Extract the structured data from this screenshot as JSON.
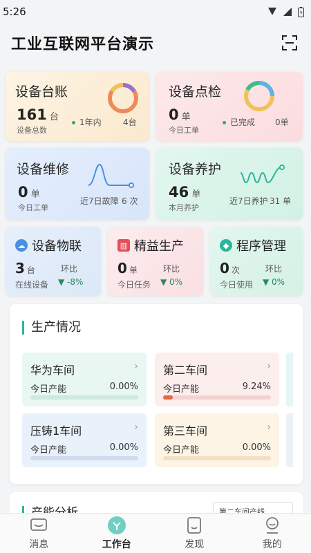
{
  "status": {
    "time": "5:26"
  },
  "header": {
    "title": "工业互联网平台演示"
  },
  "cards": {
    "ledger": {
      "title": "设备台账",
      "value": "161",
      "unit": "台",
      "label": "设备总数",
      "meta_label": "1年内",
      "meta_value": "4台",
      "ring_color": "#3aa66f"
    },
    "inspect": {
      "title": "设备点检",
      "value": "0",
      "unit": "单",
      "label": "今日工单",
      "meta_label": "已完成",
      "meta_value": "0单"
    },
    "repair": {
      "title": "设备维修",
      "value": "0",
      "unit": "单",
      "label": "今日工单",
      "meta_label": "近7日故障",
      "meta_value": "6 次"
    },
    "maint": {
      "title": "设备养护",
      "value": "46",
      "unit": "单",
      "label": "本月养护",
      "meta_label": "近7日养护",
      "meta_value": "31 单"
    }
  },
  "small_cards": {
    "iot": {
      "title": "设备物联",
      "value": "3",
      "unit": "台",
      "label": "在线设备",
      "ring_label": "环比",
      "trend": "▼ -8%"
    },
    "lean": {
      "title": "精益生产",
      "value": "0",
      "unit": "单",
      "label": "今日任务",
      "ring_label": "环比",
      "trend": "▼ 0%"
    },
    "prog": {
      "title": "程序管理",
      "value": "0",
      "unit": "次",
      "label": "今日使用",
      "ring_label": "环比",
      "trend": "▼ 0%"
    }
  },
  "production": {
    "title": "生产情况",
    "workshops": [
      {
        "name": "华为车间",
        "label": "今日产能",
        "value": "0.00%",
        "progress": 0.0
      },
      {
        "name": "第二车间",
        "label": "今日产能",
        "value": "9.24%",
        "progress": 0.0924
      },
      {
        "name": "压铸1车间",
        "label": "今日产能",
        "value": "0.00%",
        "progress": 0.0
      },
      {
        "name": "第三车间",
        "label": "今日产能",
        "value": "0.00%",
        "progress": 0.0
      }
    ]
  },
  "capacity": {
    "title": "产能分析",
    "selector": "第二车间产线"
  },
  "tabs": [
    {
      "label": "消息",
      "icon": "message-icon"
    },
    {
      "label": "工作台",
      "icon": "workbench-icon",
      "active": true
    },
    {
      "label": "发现",
      "icon": "discover-icon"
    },
    {
      "label": "我的",
      "icon": "profile-icon"
    }
  ]
}
